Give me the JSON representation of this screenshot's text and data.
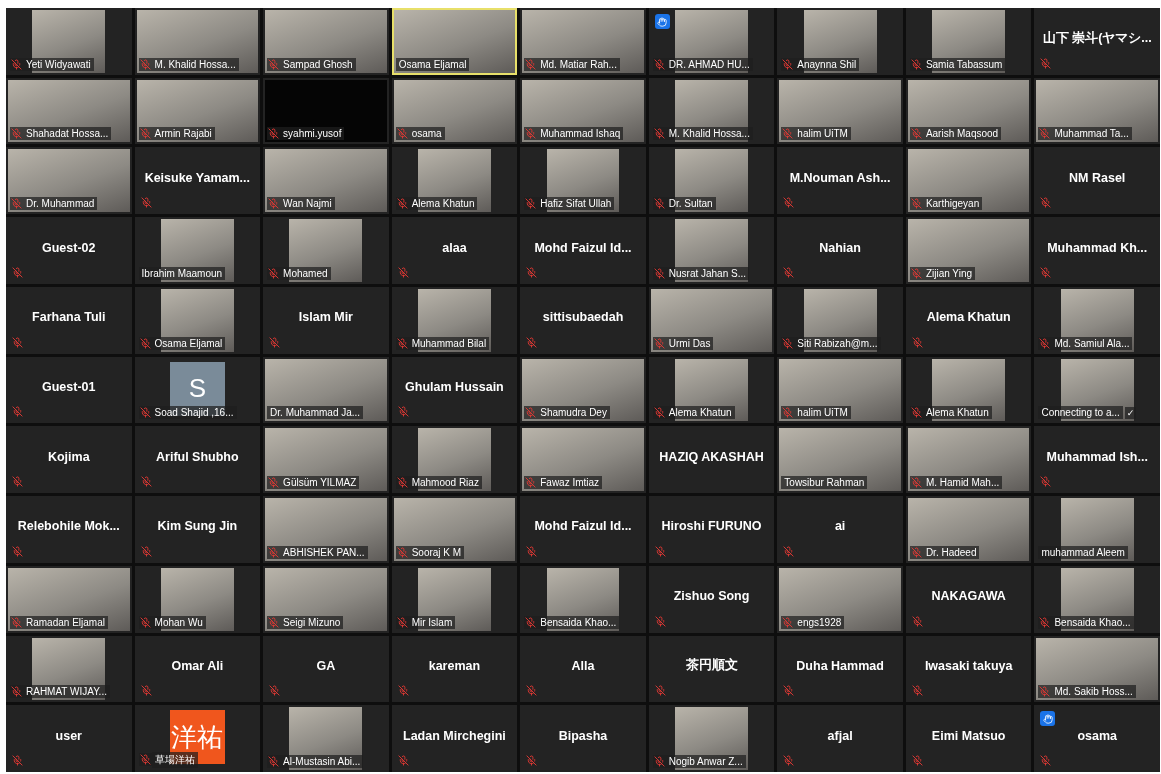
{
  "tiles": [
    {
      "kind": "portrait",
      "name": "Yeti Widyawati",
      "muted": true
    },
    {
      "kind": "video",
      "name": "M. Khalid Hossa...",
      "muted": true
    },
    {
      "kind": "video",
      "name": "Sampad Ghosh",
      "muted": true
    },
    {
      "kind": "video",
      "name": "Osama Eljamal",
      "muted": false,
      "speaking": true
    },
    {
      "kind": "video",
      "name": "Md. Matiar Rah...",
      "muted": true
    },
    {
      "kind": "portrait",
      "name": "DR. AHMAD HU...",
      "muted": true,
      "hand_raised": true
    },
    {
      "kind": "portrait",
      "name": "Anaynna Shil",
      "muted": true
    },
    {
      "kind": "portrait",
      "name": "Samia Tabassum",
      "muted": true
    },
    {
      "kind": "name",
      "name": "山下 崇斗(ヤマシ...",
      "muted": true
    },
    {
      "kind": "video",
      "name": "Shahadat Hossa...",
      "muted": true
    },
    {
      "kind": "video",
      "name": "Armin Rajabi",
      "muted": true
    },
    {
      "kind": "dark",
      "name": "syahmi.yusof",
      "muted": true
    },
    {
      "kind": "video",
      "name": "osama",
      "muted": true
    },
    {
      "kind": "video",
      "name": "Muhammad Ishaq",
      "muted": true
    },
    {
      "kind": "portrait",
      "name": "M. Khalid Hossa...",
      "muted": true
    },
    {
      "kind": "video",
      "name": "halim UiTM",
      "muted": true
    },
    {
      "kind": "video",
      "name": "Aarish Maqsood",
      "muted": true
    },
    {
      "kind": "video",
      "name": "Muhammad Ta...",
      "muted": true
    },
    {
      "kind": "video",
      "name": "Dr. Muhammad",
      "muted": true
    },
    {
      "kind": "name",
      "name": "Keisuke Yamam...",
      "muted": true
    },
    {
      "kind": "video",
      "name": "Wan Najmi",
      "muted": true
    },
    {
      "kind": "portrait",
      "name": "Alema Khatun",
      "muted": true
    },
    {
      "kind": "portrait",
      "name": "Hafiz Sifat Ullah",
      "muted": true
    },
    {
      "kind": "portrait",
      "name": "Dr. Sultan",
      "muted": true
    },
    {
      "kind": "name",
      "name": "M.Nouman Ash...",
      "muted": true
    },
    {
      "kind": "video",
      "name": "Karthigeyan",
      "muted": true
    },
    {
      "kind": "name",
      "name": "NM Rasel",
      "muted": true
    },
    {
      "kind": "name",
      "name": "Guest-02",
      "muted": true
    },
    {
      "kind": "portrait",
      "name": "Ibrahim Maamoun",
      "muted": false
    },
    {
      "kind": "portrait",
      "name": "Mohamed",
      "muted": true
    },
    {
      "kind": "name",
      "name": "alaa",
      "muted": true
    },
    {
      "kind": "name",
      "name": "Mohd Faizul Id...",
      "muted": true
    },
    {
      "kind": "portrait",
      "name": "Nusrat Jahan S...",
      "muted": true
    },
    {
      "kind": "name",
      "name": "Nahian",
      "muted": true
    },
    {
      "kind": "video",
      "name": "Zijian Ying",
      "muted": true
    },
    {
      "kind": "name",
      "name": "Muhammad Kh...",
      "muted": true
    },
    {
      "kind": "name",
      "name": "Farhana Tuli",
      "muted": true
    },
    {
      "kind": "portrait",
      "name": "Osama Eljamal",
      "muted": true
    },
    {
      "kind": "name",
      "name": "Islam Mir",
      "muted": true
    },
    {
      "kind": "portrait",
      "name": "Muhammad Bilal",
      "muted": true
    },
    {
      "kind": "name",
      "name": "sittisubaedah",
      "muted": true
    },
    {
      "kind": "video",
      "name": "Urmi Das",
      "muted": true
    },
    {
      "kind": "portrait",
      "name": "Siti Rabizah@m...",
      "muted": true
    },
    {
      "kind": "name",
      "name": "Alema Khatun",
      "muted": true
    },
    {
      "kind": "portrait",
      "name": "Md. Samiul Ala...",
      "muted": true
    },
    {
      "kind": "name",
      "name": "Guest-01",
      "muted": true
    },
    {
      "kind": "letter",
      "letter": "S",
      "color": "#7a8b99",
      "name": "Soad Shajid ,16...",
      "muted": true
    },
    {
      "kind": "video",
      "name": "Dr. Muhammad Ja...",
      "muted": false
    },
    {
      "kind": "name",
      "name": "Ghulam Hussain",
      "muted": true
    },
    {
      "kind": "video",
      "name": "Shamudra Dey",
      "muted": true
    },
    {
      "kind": "portrait",
      "name": "Alema Khatun",
      "muted": true
    },
    {
      "kind": "video",
      "name": "halim UiTM",
      "muted": true
    },
    {
      "kind": "portrait",
      "name": "Alema Khatun",
      "muted": true
    },
    {
      "kind": "portrait",
      "name": "Connecting to a...",
      "muted": false,
      "badge": "✓"
    },
    {
      "kind": "name",
      "name": "Kojima",
      "muted": true
    },
    {
      "kind": "name",
      "name": "Ariful Shubho",
      "muted": true
    },
    {
      "kind": "video",
      "name": "Gülsüm YILMAZ",
      "muted": true
    },
    {
      "kind": "portrait",
      "name": "Mahmood Riaz",
      "muted": true
    },
    {
      "kind": "video",
      "name": "Fawaz Imtiaz",
      "muted": true
    },
    {
      "kind": "name",
      "name": "HAZIQ AKASHAH",
      "muted": false
    },
    {
      "kind": "video",
      "name": "Towsibur Rahman",
      "muted": false
    },
    {
      "kind": "video",
      "name": "M. Hamid Mah...",
      "muted": true
    },
    {
      "kind": "name",
      "name": "Muhammad Ish...",
      "muted": true
    },
    {
      "kind": "name",
      "name": "Relebohile Mok...",
      "muted": true
    },
    {
      "kind": "name",
      "name": "Kim Sung Jin",
      "muted": true
    },
    {
      "kind": "video",
      "name": "ABHISHEK PAN...",
      "muted": true
    },
    {
      "kind": "video",
      "name": "Sooraj K M",
      "muted": true
    },
    {
      "kind": "name",
      "name": "Mohd Faizul Id...",
      "muted": true
    },
    {
      "kind": "name",
      "name": "Hiroshi FURUNO",
      "muted": true
    },
    {
      "kind": "name",
      "name": "ai",
      "muted": true
    },
    {
      "kind": "video",
      "name": "Dr. Hadeed",
      "muted": true
    },
    {
      "kind": "portrait",
      "name": "muhammad Aleem",
      "muted": false
    },
    {
      "kind": "video",
      "name": "Ramadan Eljamal",
      "muted": true
    },
    {
      "kind": "portrait",
      "name": "Mohan Wu",
      "muted": true
    },
    {
      "kind": "video",
      "name": "Seigi Mizuno",
      "muted": true
    },
    {
      "kind": "portrait",
      "name": "Mir Islam",
      "muted": true
    },
    {
      "kind": "portrait",
      "name": "Bensaida Khao...",
      "muted": true
    },
    {
      "kind": "name",
      "name": "Zishuo Song",
      "muted": true
    },
    {
      "kind": "video",
      "name": "engs1928",
      "muted": true
    },
    {
      "kind": "name",
      "name": "NAKAGAWA",
      "muted": true
    },
    {
      "kind": "portrait",
      "name": "Bensaida Khao...",
      "muted": true
    },
    {
      "kind": "portrait",
      "name": "RAHMAT WIJAY...",
      "muted": true
    },
    {
      "kind": "name",
      "name": "Omar Ali",
      "muted": true
    },
    {
      "kind": "name",
      "name": "GA",
      "muted": true
    },
    {
      "kind": "name",
      "name": "kareman",
      "muted": true
    },
    {
      "kind": "name",
      "name": "Alla",
      "muted": true
    },
    {
      "kind": "name",
      "name": "茶円順文",
      "muted": true
    },
    {
      "kind": "name",
      "name": "Duha Hammad",
      "muted": true
    },
    {
      "kind": "name",
      "name": "Iwasaki takuya",
      "muted": true
    },
    {
      "kind": "video",
      "name": "Md. Sakib Hoss...",
      "muted": true
    },
    {
      "kind": "name",
      "name": "user",
      "muted": true
    },
    {
      "kind": "letter",
      "letter": "洋祐",
      "color": "#f0561d",
      "name": "草場洋祐",
      "muted": true
    },
    {
      "kind": "portrait",
      "name": "Al-Mustasin Abi...",
      "muted": true
    },
    {
      "kind": "name",
      "name": "Ladan Mirchegini",
      "muted": true
    },
    {
      "kind": "name",
      "name": "Bipasha",
      "muted": true
    },
    {
      "kind": "portrait",
      "name": "Nogib Anwar Z...",
      "muted": true
    },
    {
      "kind": "name",
      "name": "afjal",
      "muted": true
    },
    {
      "kind": "name",
      "name": "Eimi Matsuo",
      "muted": true
    },
    {
      "kind": "name",
      "name": "osama",
      "muted": true,
      "hand_raised": true
    }
  ]
}
